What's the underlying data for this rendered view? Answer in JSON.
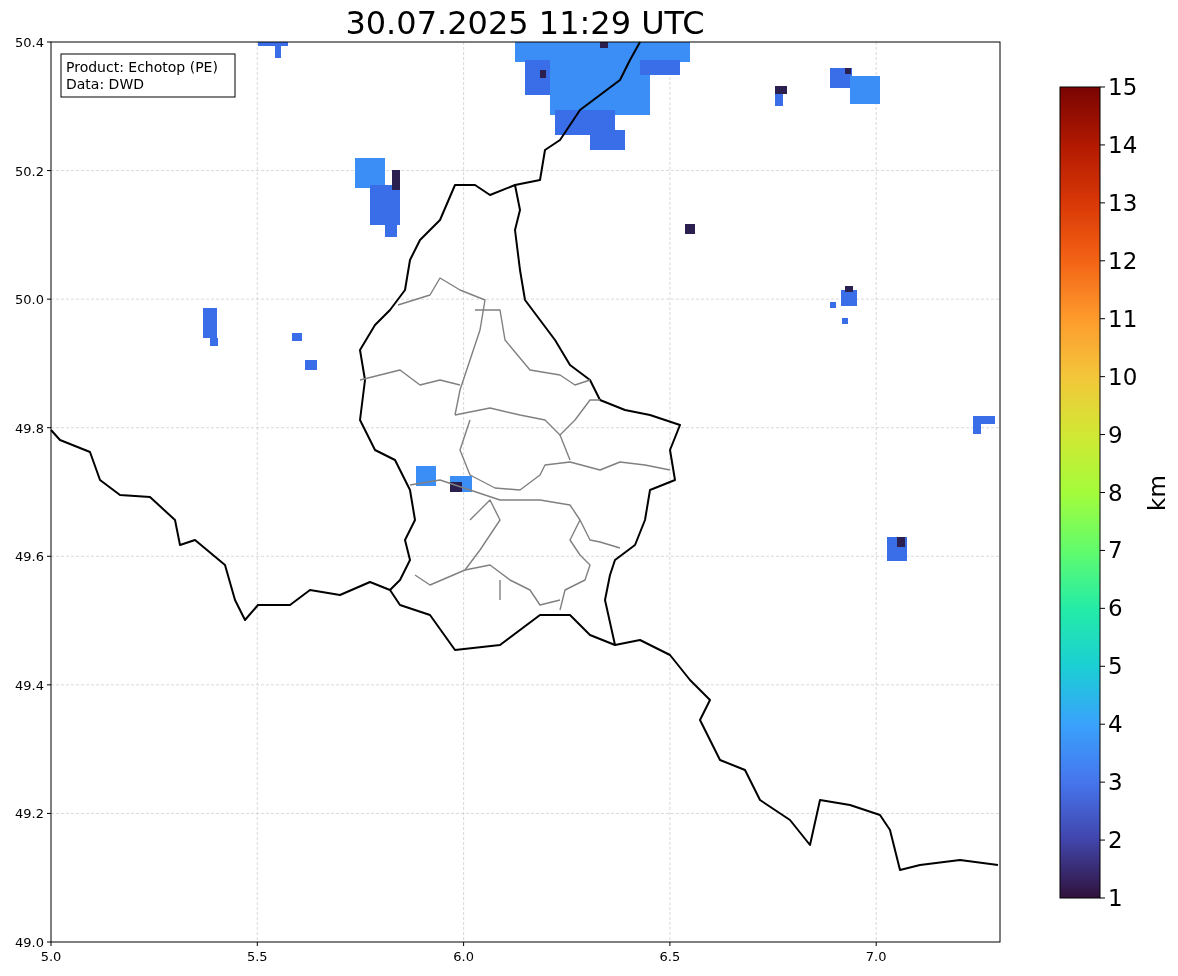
{
  "title": "30.07.2025 11:29 UTC",
  "info_box": [
    "Product: Echotop (PE)",
    "Data: DWD"
  ],
  "map": {
    "xticks": [
      "5.0",
      "5.5",
      "6.0",
      "6.5",
      "7.0"
    ],
    "yticks": [
      "50.4",
      "50.2",
      "50.0",
      "49.8",
      "49.6",
      "49.4",
      "49.2",
      "49.0"
    ]
  },
  "colorbar": {
    "label": "km",
    "ticks": [
      "15",
      "14",
      "13",
      "12",
      "11",
      "10",
      "9",
      "8",
      "7",
      "6",
      "5",
      "4",
      "3",
      "2",
      "1"
    ]
  }
}
